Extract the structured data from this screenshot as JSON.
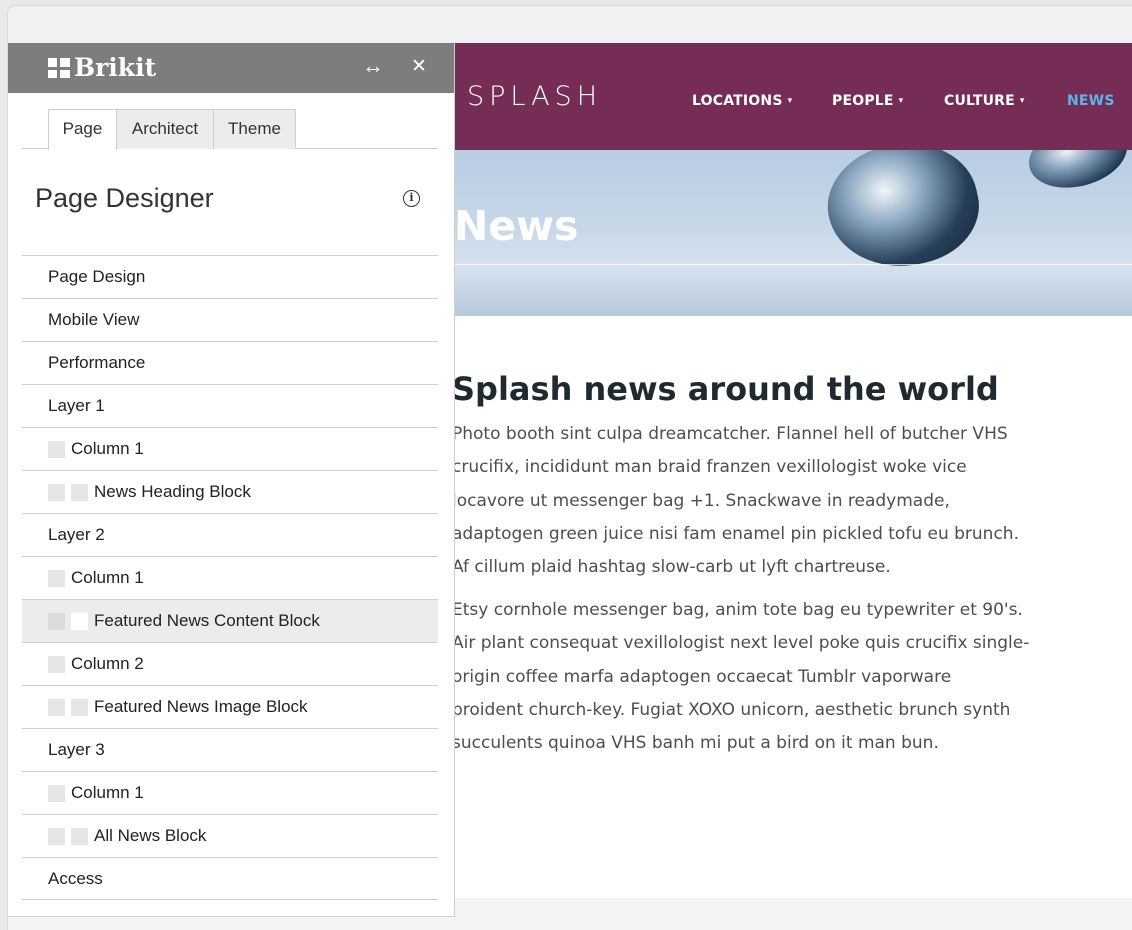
{
  "site": {
    "brand": "SPLASH",
    "nav": [
      {
        "label": "LOCATIONS",
        "dropdown": true
      },
      {
        "label": "PEOPLE",
        "dropdown": true
      },
      {
        "label": "CULTURE",
        "dropdown": true
      },
      {
        "label": "NEWS",
        "dropdown": false,
        "active": true
      }
    ],
    "caret": "▾",
    "hero_title": "News",
    "article_title": "Splash news around the world",
    "paragraph_1": "Photo booth sint culpa dreamcatcher. Flannel hell of butcher VHS\ncrucifix, incididunt man braid franzen vexillologist woke vice\nlocavore ut messenger bag +1. Snackwave in readymade,\nadaptogen green juice nisi fam enamel pin pickled tofu eu brunch.\nAf cillum plaid hashtag slow-carb ut lyft chartreuse.",
    "paragraph_2": "Etsy cornhole messenger bag, anim tote bag eu typewriter et 90's.\nAir plant consequat vexillologist next level poke quis crucifix single-\norigin coffee marfa adaptogen occaecat Tumblr vaporware\nproident church-key. Fugiat XOXO unicorn, aesthetic brunch synth\nsucculents quinoa VHS banh mi put a bird on it man bun.",
    "colors": {
      "navbar": "#762d55",
      "active_nav": "#5bb6e8"
    }
  },
  "panel": {
    "logo": "Brikit",
    "expand_icon": "↔",
    "close_icon": "✕",
    "tabs": [
      {
        "label": "Page",
        "active": true
      },
      {
        "label": "Architect",
        "active": false
      },
      {
        "label": "Theme",
        "active": false
      }
    ],
    "title": "Page Designer",
    "info_icon": "i",
    "tree": [
      {
        "label": "Page Design",
        "indent": 0
      },
      {
        "label": "Mobile View",
        "indent": 0
      },
      {
        "label": "Performance",
        "indent": 0
      },
      {
        "label": "Layer 1",
        "indent": 0
      },
      {
        "label": "Column 1",
        "indent": 1
      },
      {
        "label": "News Heading Block",
        "indent": 2
      },
      {
        "label": "Layer 2",
        "indent": 0
      },
      {
        "label": "Column 1",
        "indent": 1
      },
      {
        "label": "Featured News Content Block",
        "indent": 2,
        "selected": true
      },
      {
        "label": "Column 2",
        "indent": 1
      },
      {
        "label": "Featured News Image Block",
        "indent": 2
      },
      {
        "label": "Layer 3",
        "indent": 0
      },
      {
        "label": "Column 1",
        "indent": 1
      },
      {
        "label": "All News Block",
        "indent": 2
      },
      {
        "label": "Access",
        "indent": 0
      }
    ]
  }
}
